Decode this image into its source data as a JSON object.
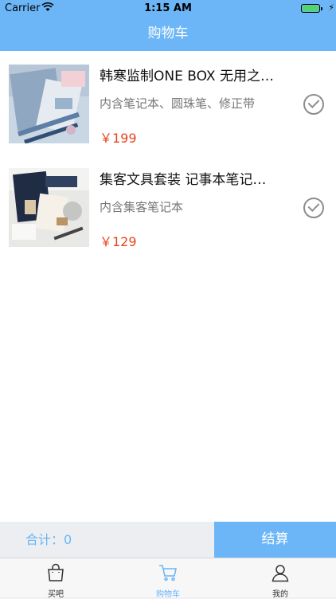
{
  "status": {
    "carrier": "Carrier",
    "time": "1:15 AM"
  },
  "nav": {
    "title": "购物车"
  },
  "items": [
    {
      "title": "韩寒监制ONE BOX 无用之…",
      "desc": "内含笔记本、圆珠笔、修正带",
      "price": "￥199",
      "selected": true
    },
    {
      "title": "集客文具套装 记事本笔记…",
      "desc": "内含集客笔记本",
      "price": "￥129",
      "selected": true
    }
  ],
  "footer": {
    "total_label": "合计：0",
    "checkout_label": "结算"
  },
  "tabbar": {
    "tabs": [
      {
        "label": "买吧",
        "icon": "shopping-bag-icon",
        "active": false
      },
      {
        "label": "购物车",
        "icon": "cart-icon",
        "active": true
      },
      {
        "label": "我的",
        "icon": "user-icon",
        "active": false
      }
    ]
  },
  "colors": {
    "accent": "#6cb6f7",
    "price": "#e8431e",
    "tab_inactive": "#333333"
  }
}
